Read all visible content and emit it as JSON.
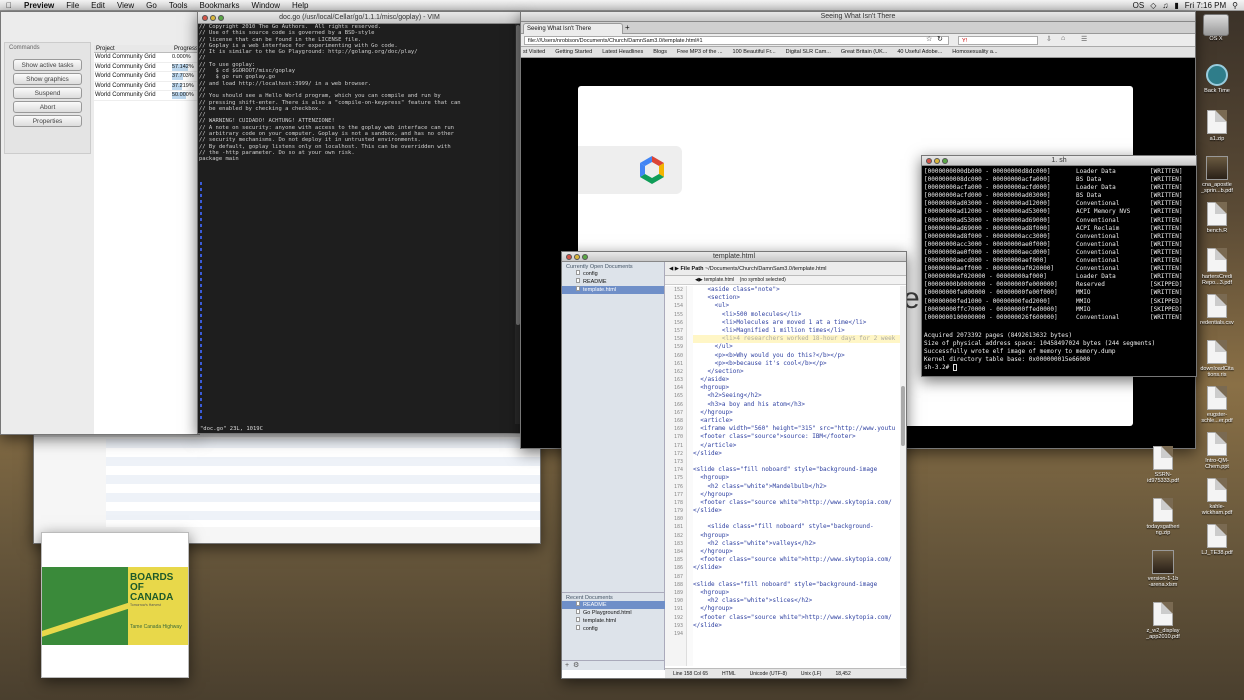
{
  "menubar": {
    "apple": "",
    "items": [
      "Preview",
      "File",
      "Edit",
      "View",
      "Go",
      "Tools",
      "Bookmarks",
      "Window",
      "Help"
    ],
    "clock": "Fri 7:16 PM",
    "status": "OS"
  },
  "boinc": {
    "commands_label": "Commands",
    "headers": [
      "Project",
      "Progress"
    ],
    "rows": [
      {
        "project": "World Community Grid",
        "progress": "0.000%",
        "fill": 0
      },
      {
        "project": "World Community Grid",
        "progress": "57.142%",
        "fill": 0.57142
      },
      {
        "project": "World Community Grid",
        "progress": "37.703%",
        "fill": 0.37703
      },
      {
        "project": "World Community Grid",
        "progress": "37.219%",
        "fill": 0.37219
      },
      {
        "project": "World Community Grid",
        "progress": "50.000%",
        "fill": 0.5
      }
    ],
    "buttons": [
      "Show active tasks",
      "Show graphics",
      "Suspend",
      "Abort",
      "Properties"
    ]
  },
  "vim": {
    "title": "doc.go (/usr/local/Cellar/go/1.1.1/misc/goplay) - VIM",
    "lines": [
      "// Copyright 2010 The Go Authors.  All rights reserved.",
      "// Use of this source code is governed by a BSD-style",
      "// license that can be found in the LICENSE file.",
      "",
      "// Goplay is a web interface for experimenting with Go code.",
      "// It is similar to the Go Playground: http://golang.org/doc/play/",
      "//",
      "// To use goplay:",
      "//   $ cd $GOROOT/misc/goplay",
      "//   $ go run goplay.go",
      "// and load http://localhost:3999/ in a web browser.",
      "//",
      "// You should see a Hello World program, which you can compile and run by",
      "// pressing shift-enter. There is also a \"compile-on-keypress\" feature that can",
      "// be enabled by checking a checkbox.",
      "//",
      "// WARNING! CUIDADO! ACHTUNG! ATTENZIONE!",
      "// A note on security: anyone with access to the goplay web interface can run",
      "// arbitrary code on your computer. Goplay is not a sandbox, and has no other",
      "// security mechanisms. Do not deploy it in untrusted environments.",
      "// By default, goplay listens only on localhost. This can be overridden with",
      "// the -http parameter. Do so at your own risk.",
      "package main"
    ],
    "status": "\"doc.go\" 23L, 1019C"
  },
  "behind": {
    "col1": "Español",
    "col2": "9 iPiDe"
  },
  "album": {
    "title_line1": "BOARDS",
    "title_line2": "OF",
    "title_line3": "CANADA",
    "subtitle": "Tomorrow's Harvest",
    "track": "Tame Canada Highway"
  },
  "firefox": {
    "window_title": "Seeing What Isn't There",
    "tab": "Seeing What Isn't There",
    "url": "file:///Users/nrobison/Documents/Church/DamnSam3.0/template.html#1",
    "search_placeholder": "Y!",
    "bookmarks": [
      "st Visited",
      "Getting Started",
      "Latest Headlines",
      "Blogs",
      "Free MP3 of the ...",
      "100 Beautiful Fr...",
      "Digital SLR Cam...",
      "Great Britain (UK...",
      "40 Useful Adobe...",
      "Homosexuality a..."
    ],
    "slide_partial": "e"
  },
  "terminal": {
    "title": "1. sh",
    "rows": [
      [
        "[0000000000db000 - 00000000d8dc000]",
        "Loader Data",
        "[WRITTEN]"
      ],
      [
        "[0000000008dc000 - 00000000acfa000]",
        "BS Data",
        "[WRITTEN]"
      ],
      [
        "[00000000acfa000 - 00000000acfd000]",
        "Loader Data",
        "[WRITTEN]"
      ],
      [
        "[00000000acfd000 - 00000000ad03000]",
        "BS Data",
        "[WRITTEN]"
      ],
      [
        "[00000000ad03000 - 00000000ad12000]",
        "Conventional",
        "[WRITTEN]"
      ],
      [
        "[00000000ad12000 - 00000000ad53000]",
        "ACPI Memory NVS",
        "[WRITTEN]"
      ],
      [
        "[00000000ad53000 - 00000000ad69000]",
        "Conventional",
        "[WRITTEN]"
      ],
      [
        "[00000000ad69000 - 00000000ad8f000]",
        "ACPI Reclaim",
        "[WRITTEN]"
      ],
      [
        "[00000000ad8f000 - 00000000acc3000]",
        "Conventional",
        "[WRITTEN]"
      ],
      [
        "[00000000acc3000 - 00000000ae0f000]",
        "Conventional",
        "[WRITTEN]"
      ],
      [
        "[00000000ae0f000 - 00000000aecd000]",
        "Conventional",
        "[WRITTEN]"
      ],
      [
        "[00000000aecd000 - 00000000aef000]",
        "Conventional",
        "[WRITTEN]"
      ],
      [
        "[00000000aeff000 - 00000000af020000]",
        "Conventional",
        "[WRITTEN]"
      ],
      [
        "[00000000af020000 - 00000000af000]",
        "Loader Data",
        "[WRITTEN]"
      ],
      [
        "[00000000b0000000 - 00000000fe000000]",
        "Reserved",
        "[SKIPPED]"
      ],
      [
        "[00000000fe000000 - 00000000fe00f000]",
        "MMIO",
        "[WRITTEN]"
      ],
      [
        "[00000000fed1000 - 00000000fed2000]",
        "MMIO",
        "[SKIPPED]"
      ],
      [
        "[00000000ffc70000 - 00000000ffed0000]",
        "MMIO",
        "[SKIPPED]"
      ],
      [
        "[0000000100000000 - 000000026f600000]",
        "Conventional",
        "[WRITTEN]"
      ]
    ],
    "footer": [
      "Acquired 2073392 pages (8492613632 bytes)",
      "Size of physical address space: 10458497024 bytes (244 segments)",
      "Successfully wrote elf image of memory to memory.dump",
      "Kernel directory table base: 0x000000015e66000",
      "sh-3.2# "
    ]
  },
  "editor": {
    "title": "template.html",
    "open_docs_label": "Currently Open Documents",
    "open_docs": [
      "config",
      "README",
      "template.html"
    ],
    "file_path_label": "File Path",
    "file_path": "~/Documents/Church/DamnSam3.0/template.html",
    "subtab": "template.html",
    "symbol": "(no symbol selected)",
    "recent_label": "Recent Documents",
    "recent_docs": [
      "README",
      "Go Playground.html",
      "template.html",
      "config"
    ],
    "line_numbers": [
      "152",
      "153",
      "154",
      "155",
      "156",
      "157",
      "158",
      "159",
      "160",
      "161",
      "162",
      "163",
      "164",
      "165",
      "166",
      "167",
      "168",
      "169",
      "170",
      "171",
      "172",
      "173",
      "174",
      "175",
      "176",
      "177",
      "178",
      "179",
      "180",
      "181",
      "182",
      "183",
      "184",
      "185",
      "186",
      "187",
      "188",
      "189",
      "190",
      "191",
      "192",
      "193",
      "194"
    ],
    "code": [
      "    <aside class=\"note\">",
      "    <section>",
      "      <ul>",
      "        <li>500 molecules</li>",
      "        <li>Molecules are moved 1 at a time</li>",
      "        <li>Magnified 1 million times</li>",
      "        <li>4 researchers worked 18-hour days for 2 week",
      "      </ul>",
      "      <p><b>Why would you do this?</b></p>",
      "      <p><b>because it's cool</b></p>",
      "    </section>",
      "  </aside>",
      "  <hgroup>",
      "    <h2>Seeing</h2>",
      "    <h3>a boy and his atom</h3>",
      "  </hgroup>",
      "  <article>",
      "  <iframe width=\"560\" height=\"315\" src=\"http://www.youtu",
      "  <footer class=\"source\">source: IBM</footer>",
      "  </article>",
      "</slide>",
      "",
      "<slide class=\"fill noboard\" style=\"background-image",
      "  <hgroup>",
      "    <h2 class=\"white\">Mandelbulb</h2>",
      "  </hgroup>",
      "  <footer class=\"source white\">http://www.skytopia.com/",
      "</slide>",
      "",
      "    <slide class=\"fill noboard\" style=\"background-",
      "  <hgroup>",
      "    <h2 class=\"white\">valleys</h2>",
      "  </hgroup>",
      "  <footer class=\"source white\">http://www.skytopia.com/",
      "</slide>",
      "",
      "<slide class=\"fill noboard\" style=\"background-image",
      "  <hgroup>",
      "    <h2 class=\"white\">slices</h2>",
      "  </hgroup>",
      "  <footer class=\"source white\">http://www.skytopia.com/",
      "</slide>",
      ""
    ],
    "status": [
      "Line 158 Col 65",
      "HTML",
      "Unicode (UTF-8)",
      "Unix (LF)",
      "18,452"
    ]
  },
  "desktop": {
    "top_label": "OS X",
    "col1": [
      {
        "label": "Back Time",
        "kind": "clock"
      },
      {
        "label": "a1.zip",
        "kind": "zip"
      },
      {
        "label": "cna_apostle\n_sprin...b.pdf",
        "kind": "img"
      },
      {
        "label": "bench.R",
        "kind": "doc"
      },
      {
        "label": "hartersCredi\nRepo...3.pdf",
        "kind": "pdf"
      },
      {
        "label": "redentials.csv",
        "kind": "doc"
      },
      {
        "label": "downloadCita\ntions.ris",
        "kind": "doc"
      },
      {
        "label": "eugster-\nschle...er.pdf",
        "kind": "pdf"
      },
      {
        "label": "Intro-QM-\nChem.ppt",
        "kind": "doc"
      },
      {
        "label": "kahle-\nwickham.pdf",
        "kind": "pdf"
      },
      {
        "label": "LJ_TE38.pdf",
        "kind": "pdf"
      }
    ],
    "col2": [
      {
        "label": "SSRN-\nid975333.pdf",
        "kind": "pdf"
      },
      {
        "label": "todaysgatheri\nng.zip",
        "kind": "zip"
      },
      {
        "label": "version-1-1b\n-arena.xlsm",
        "kind": "img"
      },
      {
        "label": "z_w2_display\n_app2010.pdf",
        "kind": "pdf"
      }
    ]
  },
  "colors": {
    "vim_bg": "#1e1e1e",
    "terminal_bg": "#000000",
    "accent": "#3d6dd8",
    "album_green": "#3a8a3a",
    "album_yellow": "#e8d84a"
  }
}
